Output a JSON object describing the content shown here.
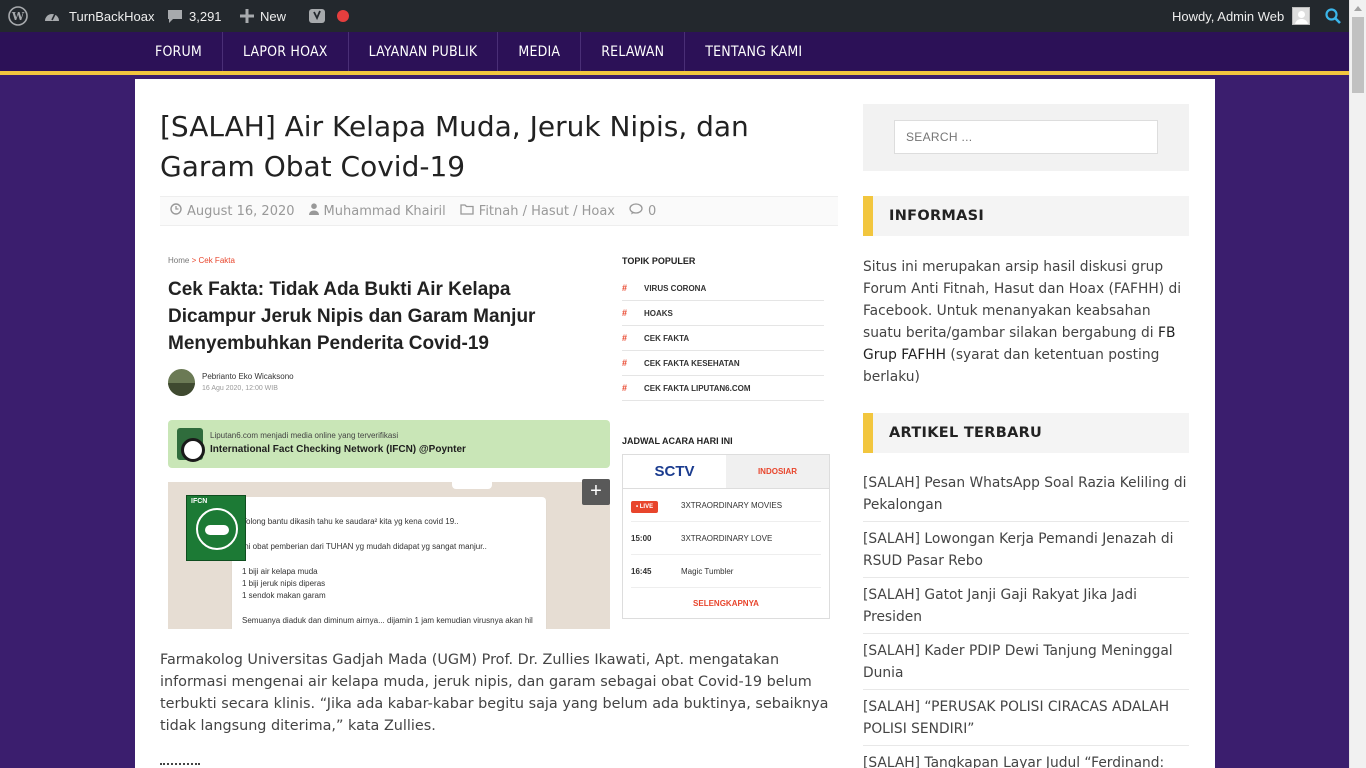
{
  "adminbar": {
    "site_name": "TurnBackHoax",
    "comments_count": "3,291",
    "new_label": "New",
    "howdy": "Howdy, Admin Web",
    "status_color": "#e53e3e"
  },
  "nav": {
    "items": [
      "FORUM",
      "LAPOR HOAX",
      "LAYANAN PUBLIK",
      "MEDIA",
      "RELAWAN",
      "TENTANG KAMI"
    ]
  },
  "article": {
    "title": "[SALAH] Air Kelapa Muda, Jeruk Nipis, dan Garam Obat Covid-19",
    "date": "August 16, 2020",
    "author": "Muhammad Khairil",
    "category": "Fitnah / Hasut / Hoax",
    "comments": "0",
    "body": "Farmakolog Universitas Gadjah Mada (UGM) Prof. Dr. Zullies Ikawati, Apt. mengatakan informasi mengenai air kelapa muda, jeruk nipis, dan garam sebagai obat Covid-19 belum terbukti secara klinis. “Jika ada kabar-kabar begitu saja yang belum ada buktinya, sebaiknya tidak langsung diterima,” kata Zullies.",
    "screenshot": {
      "breadcrumb_home": "Home",
      "breadcrumb_section": "Cek Fakta",
      "title": "Cek Fakta: Tidak Ada Bukti Air Kelapa Dicampur Jeruk Nipis dan Garam Manjur Menyembuhkan Penderita Covid-19",
      "author": "Pebrianto Eko Wicaksono",
      "date": "16 Agu 2020, 12:00 WIB",
      "ifcn_line1": "Liputan6.com menjadi media online yang terverifikasi",
      "ifcn_line2": "International Fact Checking Network (IFCN) @Poynter",
      "stamp_text": "IFCN",
      "wa_lines": [
        "Tolong bantu dikasih tahu ke saudara² kita yg kena covid 19..",
        "Ini obat pemberian dari TUHAN yg mudah didapat yg sangat manjur..",
        "1 biji air kelapa muda",
        "1 biji jeruk nipis diperas",
        "1 sendok makan garam",
        "Semuanya diaduk dan diminum airnya... dijamin 1 jam kemudian virusnya  akan hil"
      ],
      "wa_plus": "+",
      "topik_heading": "TOPIK POPULER",
      "topik_items": [
        "VIRUS CORONA",
        "HOAKS",
        "CEK FAKTA",
        "CEK FAKTA KESEHATAN",
        "CEK FAKTA LIPUTAN6.COM"
      ],
      "jadwal_heading": "JADWAL ACARA HARI INI",
      "tab_sctv": "SCTV",
      "tab_indosiar": "INDOSIAR",
      "live_label": "• LIVE",
      "schedule": [
        {
          "time": "",
          "show": "3XTRAORDINARY MOVIES"
        },
        {
          "time": "15:00",
          "show": "3XTRAORDINARY LOVE"
        },
        {
          "time": "16:45",
          "show": "Magic Tumbler"
        }
      ],
      "more_label": "SELENGKAPNYA"
    }
  },
  "sidebar": {
    "search_placeholder": "SEARCH ...",
    "info_heading": "INFORMASI",
    "info_text_1": "Situs ini merupakan arsip hasil diskusi grup Forum Anti Fitnah, Hasut dan Hoax (FAFHH) di Facebook. Untuk menanyakan keabsahan suatu berita/gambar silakan bergabung di ",
    "info_link": "FB Grup FAFHH",
    "info_text_2": " (syarat dan ketentuan posting berlaku)",
    "recent_heading": "ARTIKEL TERBARU",
    "recent_items": [
      "[SALAH] Pesan WhatsApp Soal Razia Keliling di Pekalongan",
      "[SALAH] Lowongan Kerja Pemandi Jenazah di RSUD Pasar Rebo",
      "[SALAH] Gatot Janji Gaji Rakyat Jika Jadi Presiden",
      "[SALAH] Kader PDIP Dewi Tanjung Meninggal Dunia",
      "[SALAH] “PERUSAK POLISI CIRACAS ADALAH POLISI SENDIRI”",
      "[SALAH] Tangkapan Layar Judul “Ferdinand:"
    ]
  },
  "colors": {
    "page_bg": "#3b1e6e",
    "nav_bg": "#2c1157",
    "accent": "#f2c63e",
    "adminbar_bg": "#23282d"
  }
}
